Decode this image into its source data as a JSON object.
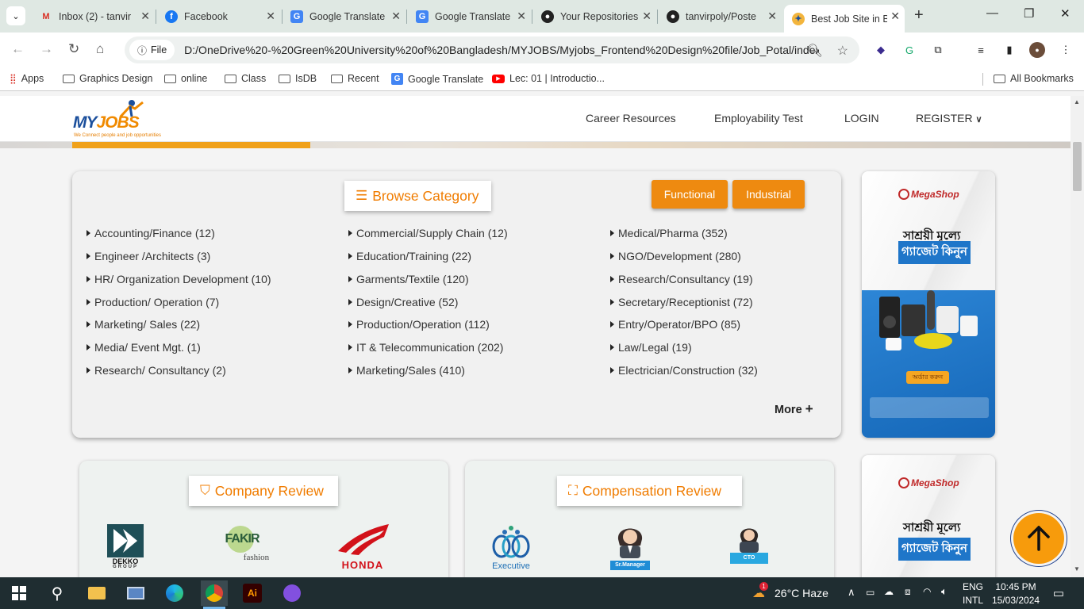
{
  "browser": {
    "tabs": [
      {
        "title": "Inbox (2) - tanvir",
        "icon": "gmail-icon"
      },
      {
        "title": "Facebook",
        "icon": "facebook-icon"
      },
      {
        "title": "Google Translate",
        "icon": "google-translate-icon"
      },
      {
        "title": "Google Translate",
        "icon": "google-translate-icon"
      },
      {
        "title": "Your Repositories",
        "icon": "github-icon"
      },
      {
        "title": "tanvirpoly/Poste",
        "icon": "github-icon"
      },
      {
        "title": "Best Job Site in B",
        "icon": "chrome-icon",
        "active": true
      }
    ],
    "file_chip": "File",
    "url": "D:/OneDrive%20-%20Green%20University%20of%20Bangladesh/MYJOBS/Myjobs_Frontend%20Design%20file/Job_Potal/index...",
    "bookmarks": [
      "Apps",
      "Graphics Design",
      "online",
      "Class",
      "IsDB",
      "Recent",
      "Google Translate",
      "Lec: 01 | Introductio...",
      "All Bookmarks"
    ]
  },
  "site": {
    "logo_text_a": "MY",
    "logo_text_b": "JOBS",
    "logo_tagline": "We Connect people and job opportunities",
    "nav": {
      "career": "Career Resources",
      "employability": "Employability Test",
      "login": "LOGIN",
      "register": "REGISTER"
    },
    "browse": {
      "title": "Browse Category",
      "toggle_functional": "Functional",
      "toggle_industrial": "Industrial",
      "col1": [
        "Accounting/Finance (12)",
        "Engineer /Architects (3)",
        "HR/ Organization Development (10)",
        "Production/ Operation (7)",
        "Marketing/ Sales (22)",
        "Media/ Event Mgt. (1)",
        "Research/ Consultancy (2)"
      ],
      "col2": [
        "Commercial/Supply Chain (12)",
        "Education/Training (22)",
        "Garments/Textile (120)",
        "Design/Creative (52)",
        "Production/Operation (112)",
        "IT & Telecommunication (202)",
        "Marketing/Sales (410)"
      ],
      "col3": [
        "Medical/Pharma (352)",
        "NGO/Development (280)",
        "Research/Consultancy (19)",
        "Secretary/Receptionist (72)",
        "Entry/Operator/BPO (85)",
        "Law/Legal (19)",
        "Electrician/Construction (32)"
      ],
      "more": "More"
    },
    "ad": {
      "brand": "MegaShop",
      "line1": "সাশ্রয়ী মূল্যে",
      "line2": "গ্যাজেট কিনুন",
      "cta": "অর্ডার করুন"
    },
    "company_review": {
      "title": "Company Review",
      "brands": [
        "DEKKO",
        "GROUP",
        "FAKIR",
        "fashion",
        "HONDA"
      ]
    },
    "compensation_review": {
      "title": "Compensation Review",
      "roles": [
        "Executive",
        "Sr.Manager",
        "CTO"
      ]
    }
  },
  "taskbar": {
    "weather": "26°C  Haze",
    "lang1": "ENG",
    "lang2": "INTL",
    "time": "10:45 PM",
    "date": "15/03/2024",
    "weather_badge": "1"
  },
  "colors": {
    "accent": "#f07c00",
    "button": "#ee8a10",
    "brand_blue": "#1b4f9c"
  }
}
